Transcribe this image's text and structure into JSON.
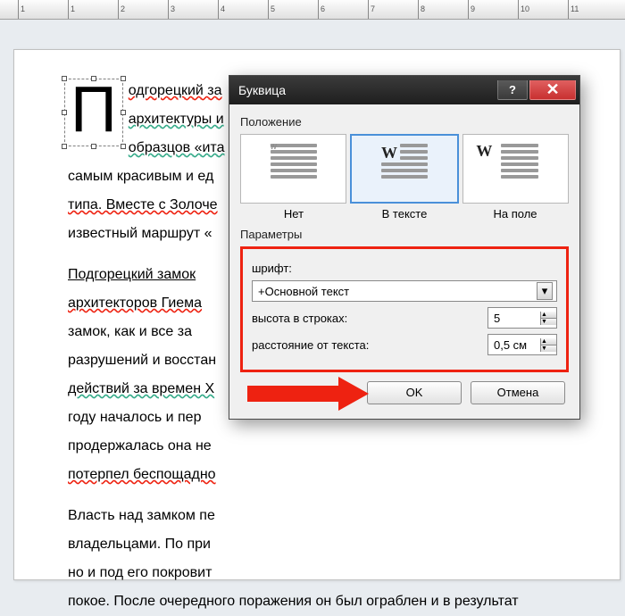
{
  "ruler": {
    "marks": [
      "1",
      "1",
      "2",
      "3",
      "4",
      "5",
      "6",
      "7",
      "8",
      "9",
      "10",
      "11"
    ]
  },
  "document": {
    "dropcap_letter": "П",
    "para1_l1": "одгорецкий за",
    "para1_l2": "архитектуры и",
    "para1_l3": "образцов «ита",
    "para1_l4": "самым красивым и ед",
    "para1_l5": "типа. Вместе с Золоче",
    "para1_l6": "известный маршрут «",
    "para2_l1": "Подгорецкий замок",
    "para2_l2": "архитекторов Гиема",
    "para2_l3": "замок, как и все за",
    "para2_l4": "разрушений и восстан",
    "para2_l5": "действий за времен X",
    "para2_l6": "году началось и пер",
    "para2_l7": "продержалась она не",
    "para2_l8": "потерпел беспощадно",
    "para3_l1": "Власть над замком пе",
    "para3_l2": "владельцами. По при",
    "para3_l3": "но и под его покровит",
    "para3_l4": "покое. После очередного поражения он был ограблен и в результат"
  },
  "dialog": {
    "title": "Буквица",
    "section_position": "Положение",
    "pos_none": "Нет",
    "pos_intext": "В тексте",
    "pos_margin": "На поле",
    "section_params": "Параметры",
    "label_font": "шрифт:",
    "font_value": "+Основной текст",
    "label_height": "высота в строках:",
    "height_value": "5",
    "label_dist": "расстояние от текста:",
    "dist_value": "0,5 см",
    "btn_ok": "OK",
    "btn_cancel": "Отмена"
  }
}
